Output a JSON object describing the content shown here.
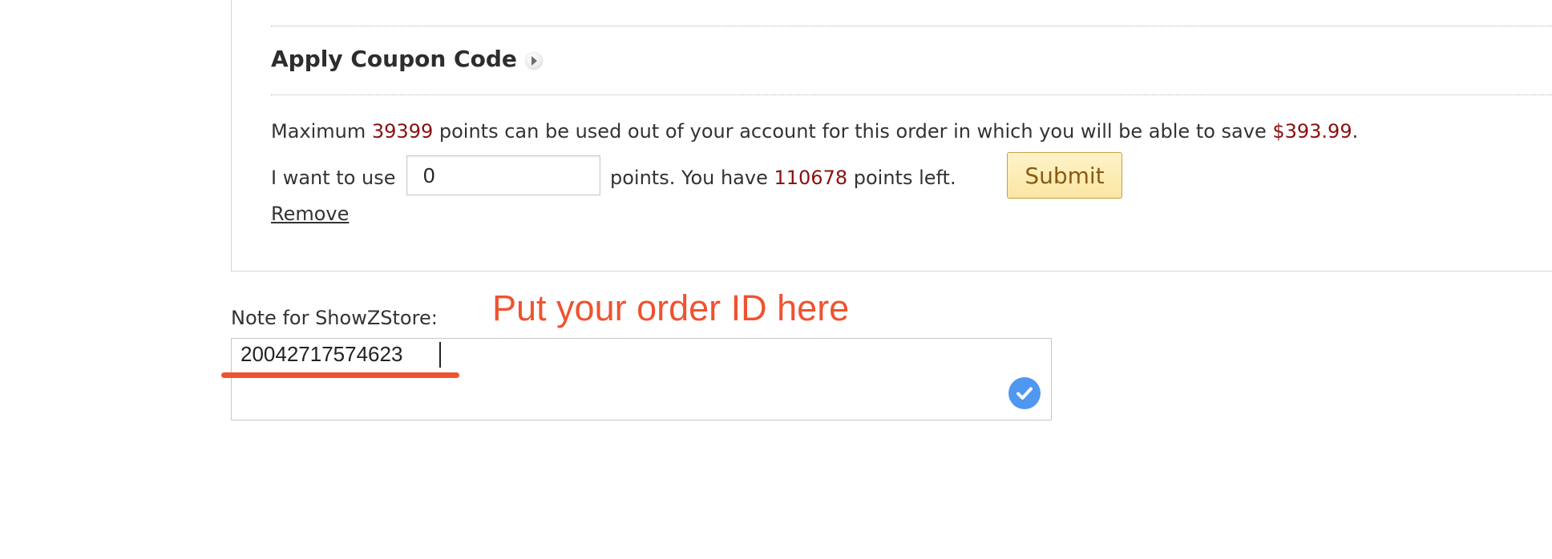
{
  "coupon": {
    "title": "Apply Coupon Code",
    "arrow_icon": "play-arrow-icon"
  },
  "points": {
    "line_prefix": "Maximum ",
    "max_points": "39399",
    "line_middle": " points can be used out of your account for this order in which you will be able to save ",
    "save_amount": "$393.99",
    "line_suffix": ".",
    "use_label": "I want to use",
    "use_value": "0",
    "left_prefix": "points. You have ",
    "points_left": "110678",
    "left_suffix": " points left.",
    "submit_label": "Submit",
    "remove_label": "Remove"
  },
  "note": {
    "label": "Note for ShowZStore:",
    "value": "20042717574623",
    "check_icon": "check-circle-icon"
  },
  "annotation": {
    "text": "Put your order ID here",
    "color": "#ef5330"
  },
  "colors": {
    "highlight_red": "#8b1010",
    "submit_bg": "#fbe6a2",
    "submit_text": "#8a5a14",
    "check_blue": "#4f97f0"
  }
}
